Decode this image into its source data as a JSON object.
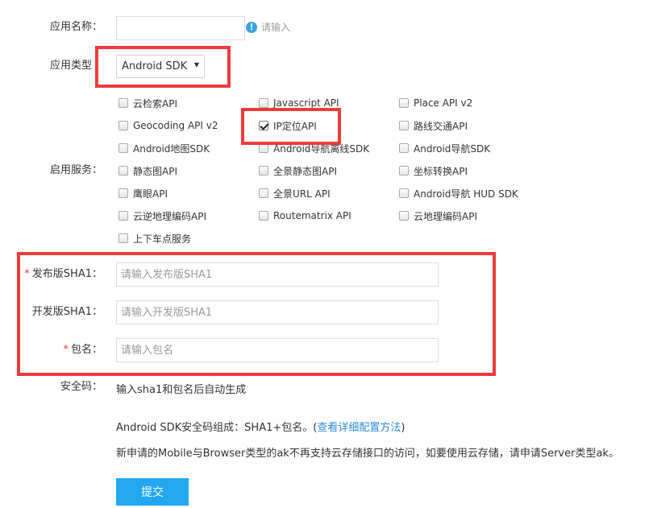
{
  "form": {
    "app_name_label": "应用名称：",
    "app_name_value": "",
    "app_name_hint_icon": "!",
    "app_name_hint": "请输入",
    "app_type_label": "应用类型",
    "app_type_value": "Android SDK",
    "app_type_arrow": "▼",
    "services_label": "启用服务：",
    "services": [
      {
        "label": "云检索API",
        "checked": false
      },
      {
        "label": "Javascript API",
        "checked": false
      },
      {
        "label": "Place API v2",
        "checked": false
      },
      {
        "label": "Geocoding API v2",
        "checked": false
      },
      {
        "label": "IP定位API",
        "checked": true
      },
      {
        "label": "路线交通API",
        "checked": false
      },
      {
        "label": "Android地图SDK",
        "checked": false
      },
      {
        "label": "Android导航离线SDK",
        "checked": false
      },
      {
        "label": "Android导航SDK",
        "checked": false
      },
      {
        "label": "静态图API",
        "checked": false
      },
      {
        "label": "全景静态图API",
        "checked": false
      },
      {
        "label": "坐标转换API",
        "checked": false
      },
      {
        "label": "鹰眼API",
        "checked": false
      },
      {
        "label": "全景URL API",
        "checked": false
      },
      {
        "label": "Android导航 HUD SDK",
        "checked": false
      },
      {
        "label": "云逆地理编码API",
        "checked": false
      },
      {
        "label": "Routematrix API",
        "checked": false
      },
      {
        "label": "云地理编码API",
        "checked": false
      },
      {
        "label": "上下车点服务",
        "checked": false
      }
    ],
    "required_mark": "*",
    "release_sha1_label": "发布版SHA1：",
    "release_sha1_placeholder": "请输入发布版SHA1",
    "dev_sha1_label": "开发版SHA1：",
    "dev_sha1_placeholder": "请输入开发版SHA1",
    "package_label": "包名：",
    "package_placeholder": "请输入包名",
    "security_code_label": "安全码：",
    "security_code_text": "输入sha1和包名后自动生成",
    "sdk_info_prefix": "Android SDK安全码组成：SHA1+包名。(",
    "sdk_info_link": "查看详细配置方法",
    "sdk_info_suffix": ")",
    "notice": "新申请的Mobile与Browser类型的ak不再支持云存储接口的访问，如要使用云存储，请申请Server类型ak。",
    "submit_label": "提交"
  },
  "colors": {
    "highlight_border": "#ef3b3b",
    "submit_bg": "#22a7f0",
    "link": "#2e8bd8",
    "hint_icon": "#3aa3e3"
  }
}
